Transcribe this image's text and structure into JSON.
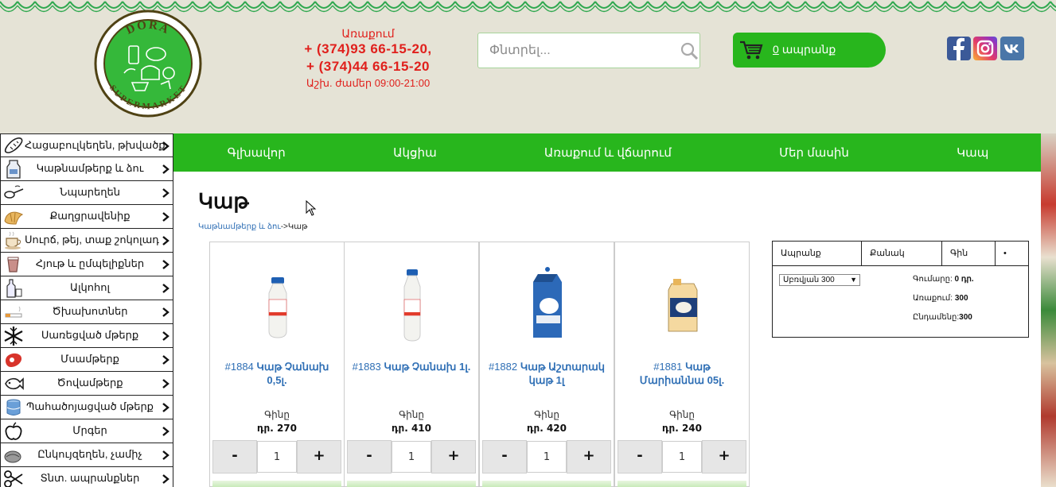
{
  "brand": {
    "logo_top": "DORA",
    "logo_bottom": "SUPERMARKET"
  },
  "contact": {
    "delivery_label": "Առաքում",
    "phone1": "+ (374)93 66-15-20,",
    "phone2": "+ (374)44 66-15-20",
    "hours": "Աշխ. ժամեր 09:00-21:00"
  },
  "search": {
    "placeholder": "Փնտրել..."
  },
  "cart": {
    "count": "0",
    "label": "ապրանք"
  },
  "social": [
    "facebook-icon",
    "instagram-icon",
    "vk-icon"
  ],
  "sidebar": {
    "items": [
      {
        "label": "Հացաբուլկեղեն, թխվածք",
        "icon": "bread-icon"
      },
      {
        "label": "Կաթնամթերք և ձու",
        "icon": "milk-carton-icon"
      },
      {
        "label": "Նպարեղեն",
        "icon": "spoon-icon"
      },
      {
        "label": "Քաղցրավենիք",
        "icon": "croissant-icon"
      },
      {
        "label": "Սուրճ, թեյ, տաք շոկոլադ",
        "icon": "coffee-cup-icon"
      },
      {
        "label": "Հյութ և ըմպելիքներ",
        "icon": "juice-icon"
      },
      {
        "label": "Ալկոհոլ",
        "icon": "bottle-icon"
      },
      {
        "label": "Ծխախոտներ",
        "icon": "cigarette-icon"
      },
      {
        "label": "Սառեցված մթերք",
        "icon": "snowflake-icon"
      },
      {
        "label": "Մսամթերք",
        "icon": "meat-icon"
      },
      {
        "label": "Ծովամթերք",
        "icon": "fish-icon"
      },
      {
        "label": "Պահածոյացված մթերք",
        "icon": "canned-food-icon"
      },
      {
        "label": "Մրգեր",
        "icon": "apple-icon"
      },
      {
        "label": "Ընկույզեղեն, չամիչ",
        "icon": "nuts-icon"
      },
      {
        "label": "Տնտ. ապրանքներ",
        "icon": "scissors-icon"
      }
    ]
  },
  "nav": {
    "items": [
      "Գլխավոր",
      "Ակցիա",
      "Առաքում և վճարում",
      "Մեր մասին",
      "Կապ"
    ]
  },
  "page": {
    "title": "Կաթ",
    "breadcrumb_link": "Կաթնամթերք և ձու",
    "breadcrumb_sep": "->",
    "breadcrumb_current": "Կաթ"
  },
  "products": [
    {
      "id": "#1884",
      "name": "Կաթ Չանախ 0,5լ.",
      "price_label": "Գինը",
      "price": "դր. 270",
      "qty": "1"
    },
    {
      "id": "#1883",
      "name": "Կաթ Չանախ 1լ.",
      "price_label": "Գինը",
      "price": "դր. 410",
      "qty": "1"
    },
    {
      "id": "#1882",
      "name": "Կաթ Աշտարակ կաթ 1լ",
      "price_label": "Գինը",
      "price": "դր. 420",
      "qty": "1"
    },
    {
      "id": "#1881",
      "name": "Կաթ Մարիաննա 05լ.",
      "price_label": "Գինը",
      "price": "դր. 240",
      "qty": "1"
    }
  ],
  "qty_buttons": {
    "minus": "-",
    "plus": "+"
  },
  "cart_table": {
    "headers": [
      "Ապրանք",
      "Քանակ",
      "Գին",
      "•"
    ],
    "select_value": "Սբռվյան 300",
    "sum_label": "Գումարը:",
    "sum_value": "0 դր.",
    "delivery_label": "Առաքում:",
    "delivery_value": "300",
    "total_label": "Ընդամենը:",
    "total_value": "300"
  },
  "colors": {
    "green": "#28b61d",
    "header_bg": "#e5e3d6",
    "red": "#e0201c",
    "link": "#2f6fb5"
  }
}
